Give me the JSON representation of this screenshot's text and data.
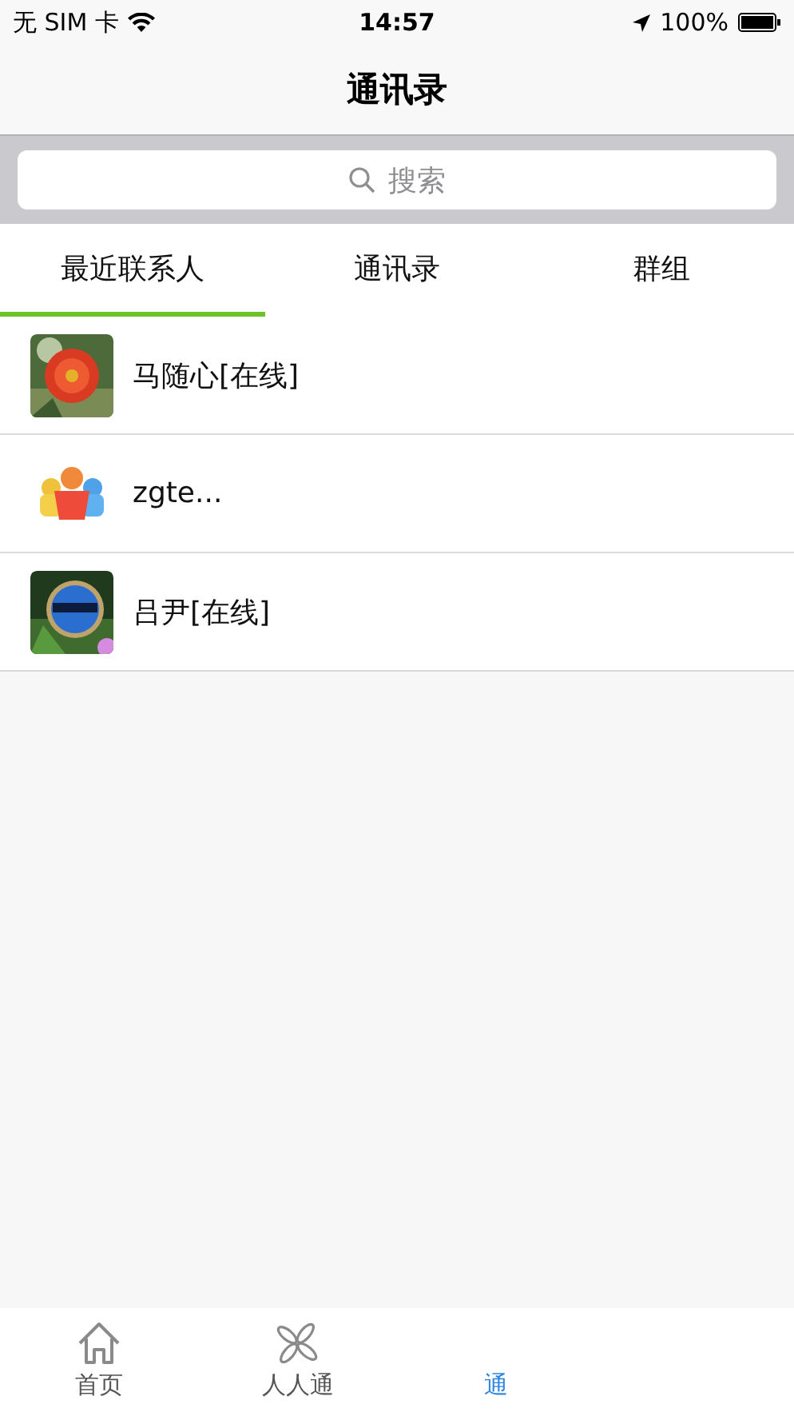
{
  "status_bar": {
    "carrier": "无 SIM 卡",
    "time": "14:57",
    "battery": "100%"
  },
  "nav": {
    "title": "通讯录"
  },
  "search": {
    "placeholder": "搜索"
  },
  "segments": [
    {
      "label": "最近联系人",
      "selected": true
    },
    {
      "label": "通讯录",
      "selected": false
    },
    {
      "label": "群组",
      "selected": false
    }
  ],
  "contacts": [
    {
      "name": "马随心[在线]"
    },
    {
      "name": "zgte..."
    },
    {
      "name": "吕尹[在线]"
    }
  ],
  "tab_bar": [
    {
      "label": "首页",
      "kind": "home",
      "selected": false
    },
    {
      "label": "人人通",
      "kind": "fan",
      "selected": false
    },
    {
      "label": "通",
      "kind": "hidden",
      "selected": true
    }
  ]
}
